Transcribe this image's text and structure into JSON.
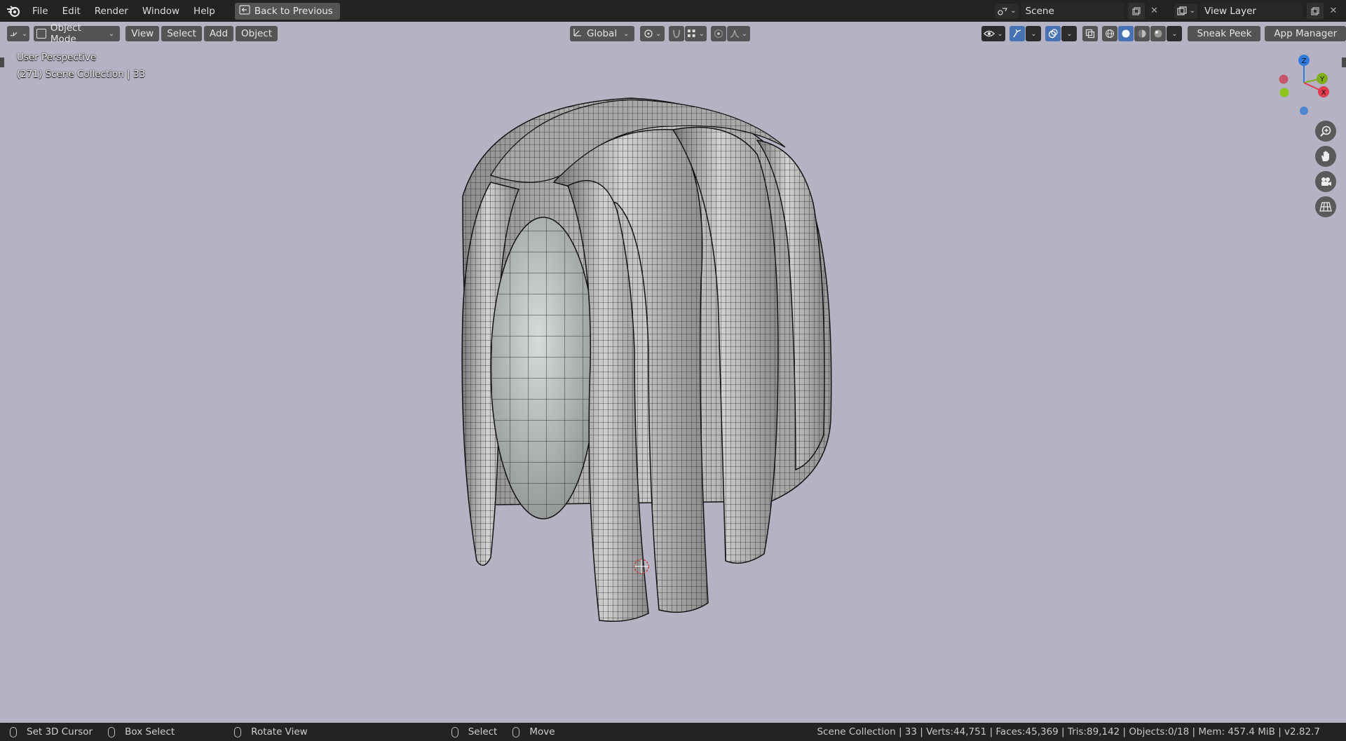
{
  "topbar": {
    "menu": [
      "File",
      "Edit",
      "Render",
      "Window",
      "Help"
    ],
    "back_button": "Back to Previous",
    "scene": "Scene",
    "view_layer": "View Layer"
  },
  "header": {
    "mode": "Object Mode",
    "menus": [
      "View",
      "Select",
      "Add",
      "Object"
    ],
    "transform_orientation": "Global",
    "sneak_peek": "Sneak Peek",
    "app_manager": "App Manager"
  },
  "viewport": {
    "perspective": "User Perspective",
    "collection_info": "(271) Scene Collection | 33",
    "gizmo_axes": [
      "Z",
      "Y",
      "X"
    ]
  },
  "statusbar": {
    "hints": [
      "Set 3D Cursor",
      "Box Select",
      "Rotate View",
      "Select",
      "Move"
    ],
    "stats": "Scene Collection | 33 | Verts:44,751 | Faces:45,369 | Tris:89,142 | Objects:0/18 | Mem: 457.4 MiB | v2.82.7"
  },
  "colors": {
    "viewport_bg": "#b5b2c4",
    "topbar_bg": "#232323",
    "button_bg": "#545454",
    "axis_x": "#e23c4f",
    "axis_y": "#7fb01a",
    "axis_z": "#2e7ce0"
  },
  "icons": [
    "blender-logo-icon",
    "back-arrow-icon",
    "scene-icon",
    "view-layer-icon",
    "editor-type-icon",
    "object-mode-icon",
    "transform-orientation-icon",
    "pivot-icon",
    "snap-icon",
    "proportional-edit-icon",
    "visibility-icon",
    "gizmo-icon",
    "overlay-icon",
    "xray-icon",
    "shading-wireframe-icon",
    "shading-solid-icon",
    "shading-material-icon",
    "shading-rendered-icon",
    "zoom-icon",
    "pan-hand-icon",
    "camera-icon",
    "grid-icon",
    "mouse-icon",
    "3d-cursor-icon"
  ]
}
